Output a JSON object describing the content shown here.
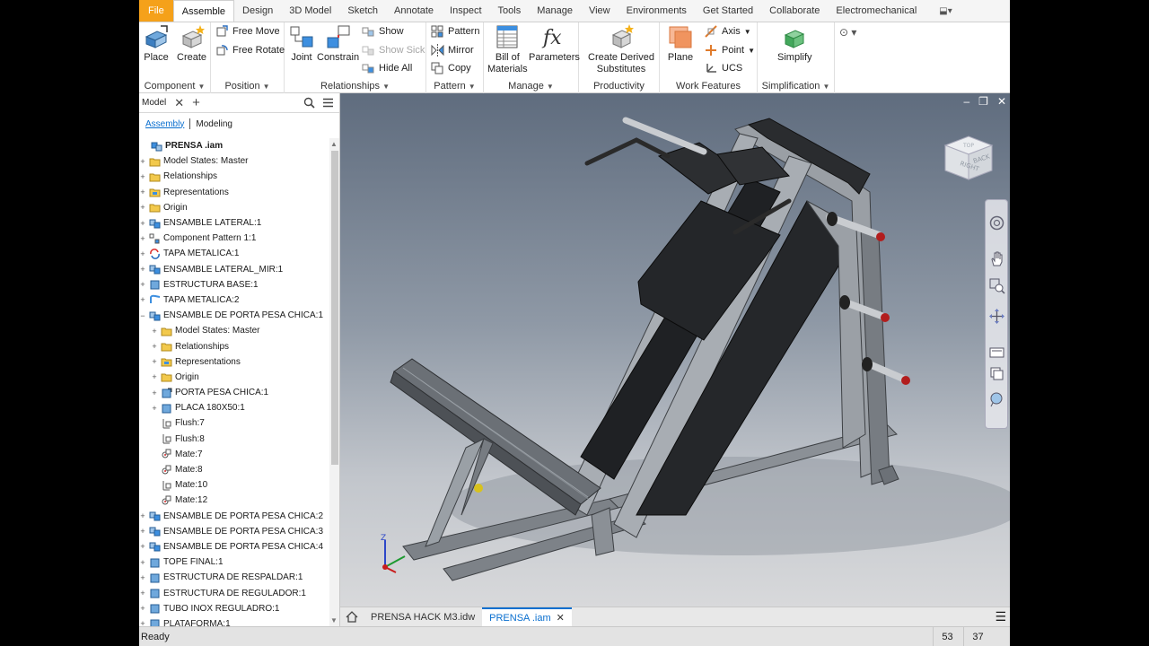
{
  "menu_tabs": [
    "File",
    "Assemble",
    "Design",
    "3D Model",
    "Sketch",
    "Annotate",
    "Inspect",
    "Tools",
    "Manage",
    "View",
    "Environments",
    "Get Started",
    "Collaborate",
    "Electromechanical"
  ],
  "active_tab": "Assemble",
  "ribbon": {
    "component": {
      "title": "Component",
      "place": "Place",
      "create": "Create"
    },
    "position": {
      "title": "Position",
      "free_move": "Free Move",
      "free_rotate": "Free Rotate"
    },
    "relationships": {
      "title": "Relationships",
      "joint": "Joint",
      "constrain": "Constrain",
      "show": "Show",
      "show_sick": "Show Sick",
      "hide_all": "Hide All"
    },
    "pattern": {
      "title": "Pattern",
      "pattern": "Pattern",
      "mirror": "Mirror",
      "copy": "Copy"
    },
    "manage": {
      "title": "Manage",
      "bom_1": "Bill of",
      "bom_2": "Materials",
      "parameters": "Parameters"
    },
    "productivity": {
      "title": "Productivity",
      "derived_1": "Create Derived",
      "derived_2": "Substitutes"
    },
    "work_features": {
      "title": "Work Features",
      "plane": "Plane",
      "axis": "Axis",
      "point": "Point",
      "ucs": "UCS"
    },
    "simplification": {
      "title": "Simplification",
      "simplify": "Simplify"
    }
  },
  "browser": {
    "tab_label": "Model",
    "sub_tabs": [
      "Assembly",
      "Modeling"
    ],
    "tree": [
      {
        "label": "PRENSA .iam",
        "level": 0,
        "toggle": "",
        "icon": "asm"
      },
      {
        "label": "Model States: Master",
        "level": 1,
        "toggle": "+",
        "icon": "folder"
      },
      {
        "label": "Relationships",
        "level": 1,
        "toggle": "+",
        "icon": "folder"
      },
      {
        "label": "Representations",
        "level": 1,
        "toggle": "+",
        "icon": "rep"
      },
      {
        "label": "Origin",
        "level": 1,
        "toggle": "+",
        "icon": "folder"
      },
      {
        "label": "ENSAMBLE LATERAL:1",
        "level": 1,
        "toggle": "+",
        "icon": "subasm"
      },
      {
        "label": "Component Pattern 1:1",
        "level": 1,
        "toggle": "+",
        "icon": "pattern"
      },
      {
        "label": "TAPA METALICA:1",
        "level": 1,
        "toggle": "+",
        "icon": "cycle"
      },
      {
        "label": "ENSAMBLE LATERAL_MIR:1",
        "level": 1,
        "toggle": "+",
        "icon": "subasm"
      },
      {
        "label": "ESTRUCTURA BASE:1",
        "level": 1,
        "toggle": "+",
        "icon": "part"
      },
      {
        "label": "TAPA METALICA:2",
        "level": 1,
        "toggle": "+",
        "icon": "tapa"
      },
      {
        "label": "ENSAMBLE DE PORTA PESA CHICA:1",
        "level": 1,
        "toggle": "−",
        "icon": "subasm"
      },
      {
        "label": "Model States: Master",
        "level": 2,
        "toggle": "+",
        "icon": "folder"
      },
      {
        "label": "Relationships",
        "level": 2,
        "toggle": "+",
        "icon": "folder"
      },
      {
        "label": "Representations",
        "level": 2,
        "toggle": "+",
        "icon": "rep"
      },
      {
        "label": "Origin",
        "level": 2,
        "toggle": "+",
        "icon": "folder"
      },
      {
        "label": "PORTA PESA CHICA:1",
        "level": 2,
        "toggle": "+",
        "icon": "part-link"
      },
      {
        "label": "PLACA 180X50:1",
        "level": 2,
        "toggle": "+",
        "icon": "part"
      },
      {
        "label": "Flush:7",
        "level": 2,
        "toggle": "",
        "icon": "flush"
      },
      {
        "label": "Flush:8",
        "level": 2,
        "toggle": "",
        "icon": "flush"
      },
      {
        "label": "Mate:7",
        "level": 2,
        "toggle": "",
        "icon": "mate"
      },
      {
        "label": "Mate:8",
        "level": 2,
        "toggle": "",
        "icon": "mate"
      },
      {
        "label": "Mate:10",
        "level": 2,
        "toggle": "",
        "icon": "flush"
      },
      {
        "label": "Mate:12",
        "level": 2,
        "toggle": "",
        "icon": "mate"
      },
      {
        "label": "ENSAMBLE DE PORTA PESA CHICA:2",
        "level": 1,
        "toggle": "+",
        "icon": "subasm"
      },
      {
        "label": "ENSAMBLE DE PORTA PESA CHICA:3",
        "level": 1,
        "toggle": "+",
        "icon": "subasm"
      },
      {
        "label": "ENSAMBLE DE PORTA PESA CHICA:4",
        "level": 1,
        "toggle": "+",
        "icon": "subasm"
      },
      {
        "label": "TOPE FINAL:1",
        "level": 1,
        "toggle": "+",
        "icon": "part"
      },
      {
        "label": "ESTRUCTURA DE RESPALDAR:1",
        "level": 1,
        "toggle": "+",
        "icon": "part"
      },
      {
        "label": "ESTRUCTURA DE REGULADOR:1",
        "level": 1,
        "toggle": "+",
        "icon": "part"
      },
      {
        "label": "TUBO INOX REGULADRO:1",
        "level": 1,
        "toggle": "+",
        "icon": "part"
      },
      {
        "label": "PLATAFORMA:1",
        "level": 1,
        "toggle": "+",
        "icon": "part"
      }
    ]
  },
  "viewcube": {
    "left": "RIGHT",
    "back": "BACK",
    "top": "TOP"
  },
  "triad": {
    "z": "Z"
  },
  "doc_tabs": [
    {
      "label": "PRENSA HACK M3.idw",
      "active": false
    },
    {
      "label": "PRENSA .iam",
      "active": true
    }
  ],
  "status": {
    "message": "Ready",
    "num1": "53",
    "num2": "37"
  },
  "colors": {
    "accent": "#0a6fcf",
    "file_tab": "#f5a11a",
    "bolt_red": "#b21d1d"
  }
}
